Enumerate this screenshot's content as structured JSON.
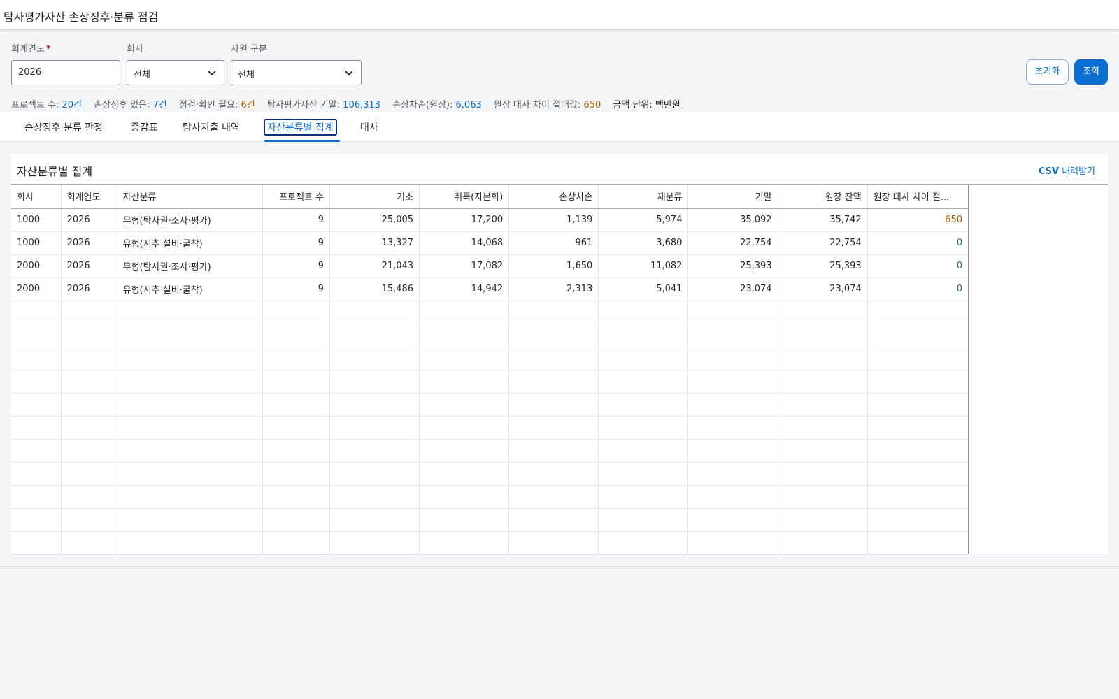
{
  "app": {
    "title": "탐사평가자산 손상징후·분류 점검"
  },
  "filters": {
    "fiscal_year": {
      "label": "회계연도",
      "required_mark": "*",
      "value": "2026"
    },
    "company": {
      "label": "회사",
      "value": "전체"
    },
    "resource_type": {
      "label": "자원 구분",
      "value": "전체"
    }
  },
  "actions": {
    "reset_label": "초기화",
    "search_label": "조회"
  },
  "summary": {
    "projects": {
      "label": "프로젝트 수:",
      "value": "20건"
    },
    "impairment_indicators": {
      "label": "손상징후 있음:",
      "value": "7건"
    },
    "needs_check": {
      "label": "점검·확인 필요:",
      "value": "6건"
    },
    "ending_balance": {
      "label": "탐사평가자산 기말:",
      "value": "106,313"
    },
    "impairment_loss": {
      "label": "손상차손(원장):",
      "value": "6,063"
    },
    "ledger_diff": {
      "label": "원장 대사 차이 절대값:",
      "value": "650"
    },
    "unit": "금액 단위: 백만원",
    "colors": {
      "blue": "#0a6ed1",
      "orange": "#b75e00"
    }
  },
  "tabs": [
    {
      "label": "손상징후·분류 판정",
      "active": false
    },
    {
      "label": "증감표",
      "active": false
    },
    {
      "label": "탐사지출 내역",
      "active": false
    },
    {
      "label": "자산분류별 집계",
      "active": true
    },
    {
      "label": "대사",
      "active": false
    }
  ],
  "panel": {
    "title": "자산분류별 집계",
    "csv_prefix": "CSV",
    "csv_suffix": "내려받기"
  },
  "table": {
    "columns": [
      "회사",
      "회계연도",
      "자산분류",
      "프로젝트 수",
      "기초",
      "취득(자본화)",
      "손상차손",
      "재분류",
      "기말",
      "원장 잔액",
      "원장 대사 차이 절..."
    ],
    "rows": [
      [
        "1000",
        "2026",
        "무형(탐사권·조사·평가)",
        "9",
        "25,005",
        "17,200",
        "1,139",
        "5,974",
        "35,092",
        "35,742",
        "650"
      ],
      [
        "1000",
        "2026",
        "유형(시추 설비·굴착)",
        "9",
        "13,327",
        "14,068",
        "961",
        "3,680",
        "22,754",
        "22,754",
        "0"
      ],
      [
        "2000",
        "2026",
        "무형(탐사권·조사·평가)",
        "9",
        "21,043",
        "17,082",
        "1,650",
        "11,082",
        "25,393",
        "25,393",
        "0"
      ],
      [
        "2000",
        "2026",
        "유형(시추 설비·굴착)",
        "9",
        "15,486",
        "14,942",
        "2,313",
        "5,041",
        "23,074",
        "23,074",
        "0"
      ]
    ],
    "diff_colors": {
      "nonzero": "#b75e00",
      "zero": "#107e3e"
    }
  }
}
